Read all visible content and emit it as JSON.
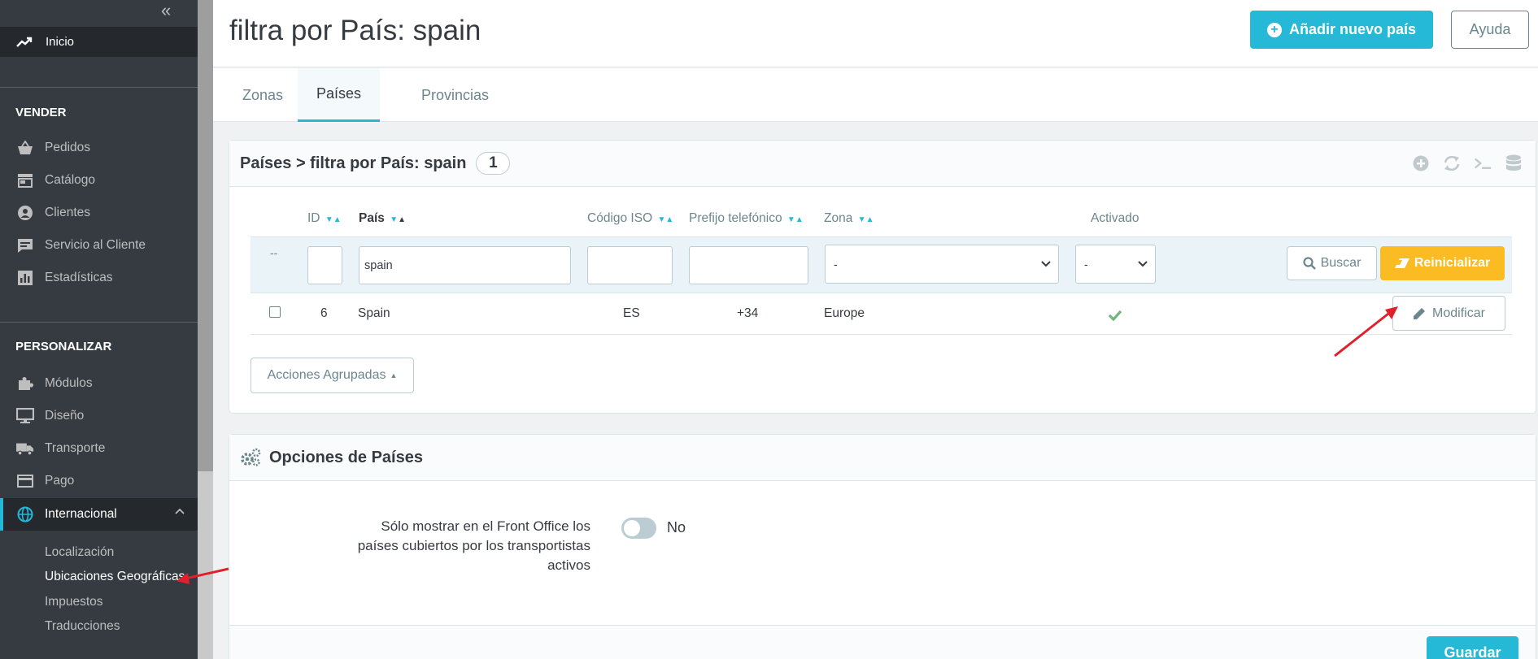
{
  "sidebar": {
    "home": "Inicio",
    "section_sell": "VENDER",
    "sell_items": [
      "Pedidos",
      "Catálogo",
      "Clientes",
      "Servicio al Cliente",
      "Estadísticas"
    ],
    "section_customize": "PERSONALIZAR",
    "customize_items": [
      "Módulos",
      "Diseño",
      "Transporte",
      "Pago",
      "Internacional"
    ],
    "international_sub": [
      "Localización",
      "Ubicaciones Geográficas",
      "Impuestos",
      "Traducciones"
    ]
  },
  "header": {
    "title": "filtra por País: spain",
    "add_button": "Añadir nuevo país",
    "help_button": "Ayuda"
  },
  "tabs": [
    "Zonas",
    "Países",
    "Provincias"
  ],
  "list_panel": {
    "title": "Países > filtra por País: spain",
    "count": "1",
    "columns": [
      "ID",
      "País",
      "Código ISO",
      "Prefijo telefónico",
      "Zona",
      "Activado"
    ],
    "filter": {
      "row_marker": "--",
      "id": "",
      "country": "spain",
      "iso": "",
      "prefix": "",
      "zone": "-",
      "active": "-",
      "search_button": "Buscar",
      "reset_button": "Reinicializar"
    },
    "rows": [
      {
        "id": "6",
        "country": "Spain",
        "iso": "ES",
        "prefix": "+34",
        "zone": "Europe",
        "active": true,
        "edit_label": "Modificar"
      }
    ],
    "bulk_actions": "Acciones Agrupadas"
  },
  "options_panel": {
    "title": "Opciones de Países",
    "option_label": "Sólo mostrar en el Front Office los países cubiertos por los transportistas activos",
    "option_value": "No",
    "save_button": "Guardar"
  },
  "colors": {
    "accent": "#25b9d7",
    "warning": "#fbbb22",
    "sidebar_bg": "#363a41",
    "annotation_arrow": "#e0202a"
  }
}
